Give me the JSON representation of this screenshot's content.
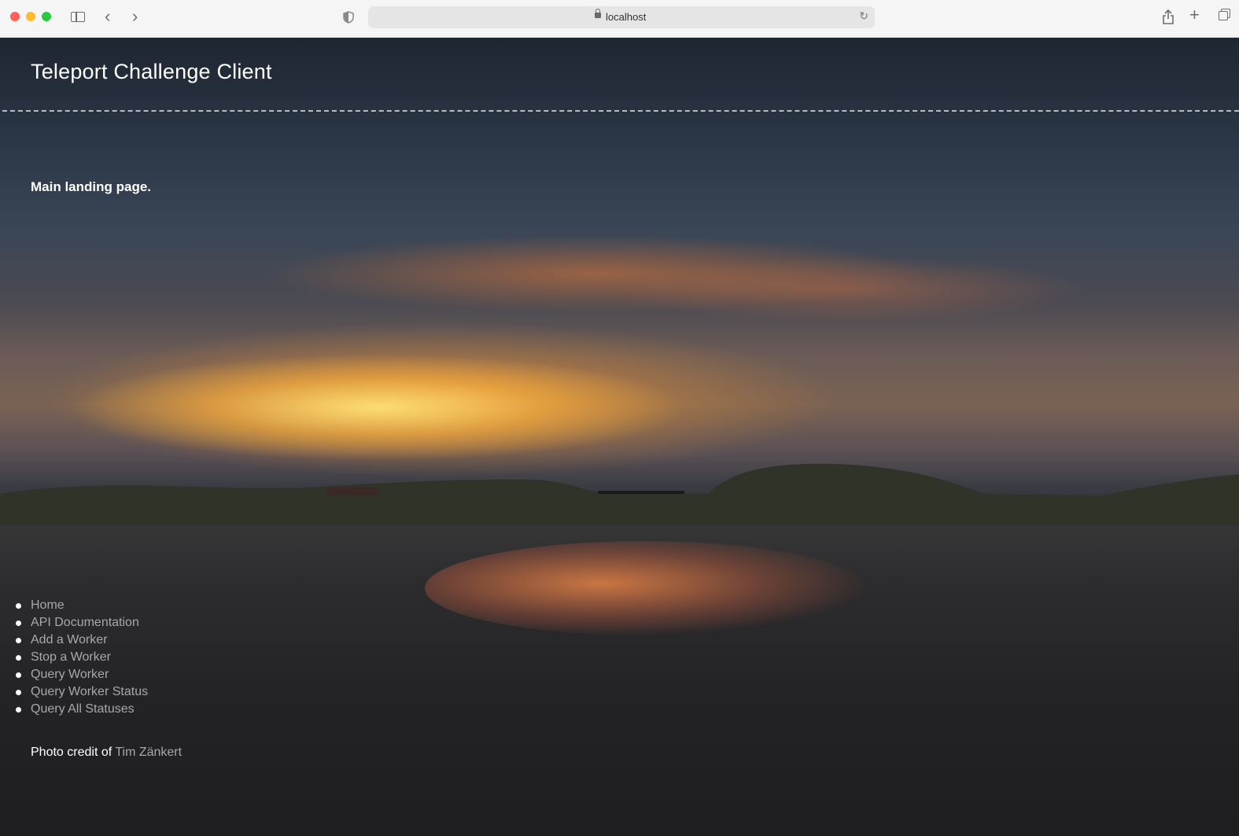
{
  "browser": {
    "url": "localhost"
  },
  "page": {
    "title": "Teleport Challenge Client",
    "intro": "Main landing page.",
    "nav": [
      {
        "label": "Home"
      },
      {
        "label": "API Documentation"
      },
      {
        "label": "Add a Worker"
      },
      {
        "label": "Stop a Worker"
      },
      {
        "label": "Query Worker"
      },
      {
        "label": "Query Worker Status"
      },
      {
        "label": "Query All Statuses"
      }
    ],
    "credit": {
      "prefix": "Photo credit of",
      "author": "Tim Zänkert"
    }
  }
}
